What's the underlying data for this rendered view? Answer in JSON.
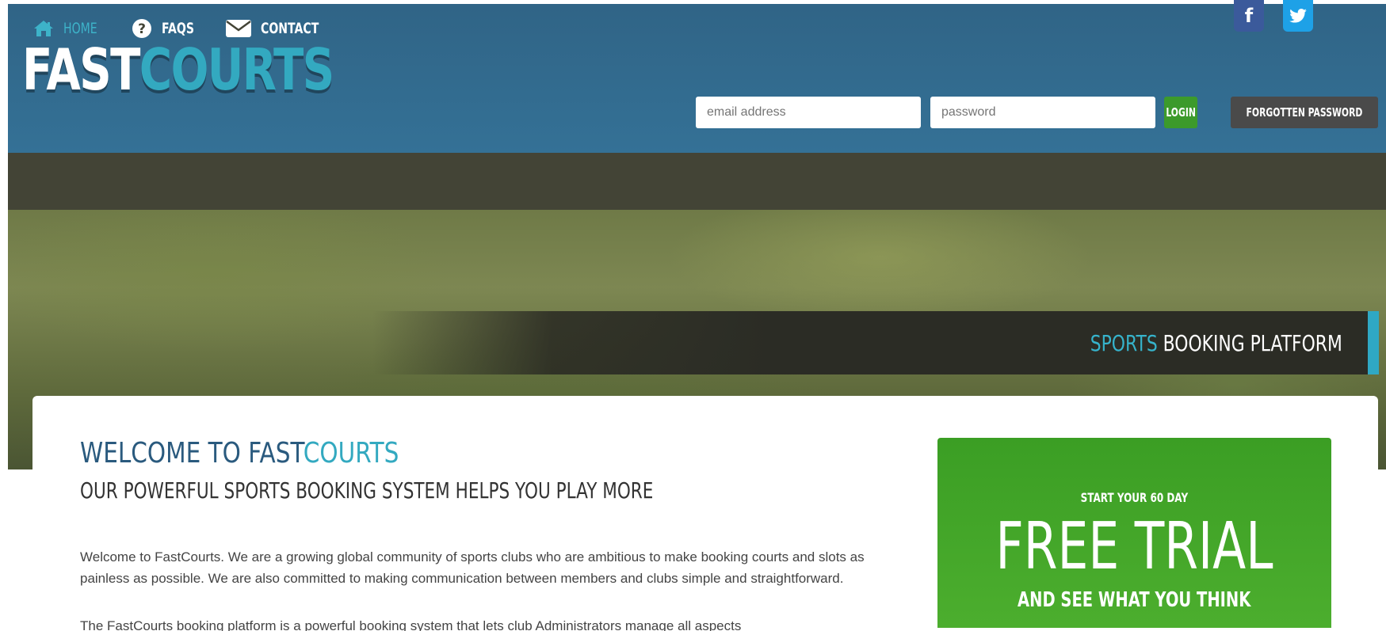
{
  "brand": {
    "logo_part1": "FAST",
    "logo_part2": "COURTS"
  },
  "social": {
    "facebook_label": "f"
  },
  "login": {
    "email_placeholder": "email address",
    "password_placeholder": "password",
    "login_label": "LOGIN",
    "forgot_label": "FORGOTTEN PASSWORD"
  },
  "nav": {
    "items": [
      {
        "label": "HOME",
        "icon": "home-icon",
        "active": true
      },
      {
        "label": "FAQS",
        "icon": "question-circle-icon",
        "active": false
      },
      {
        "label": "CONTACT",
        "icon": "envelope-icon",
        "active": false
      }
    ]
  },
  "banner": {
    "highlight": "SPORTS",
    "rest": " BOOKING PLATFORM"
  },
  "main": {
    "welcome_part1": "WELCOME TO FAST",
    "welcome_part2": "COURTS",
    "subtitle": "OUR POWERFUL SPORTS BOOKING SYSTEM HELPS YOU PLAY MORE",
    "paragraph1": "Welcome to FastCourts. We are a growing global community of sports clubs who are ambitious to make booking courts and slots as painless as possible. We are also committed to making communication between members and clubs simple and straightforward.",
    "paragraph2": "The FastCourts booking platform is a powerful booking system that lets club Administrators manage all aspects"
  },
  "trial": {
    "line1": "START YOUR 60 DAY",
    "line2": "FREE TRIAL",
    "line3": "AND SEE WHAT YOU THINK"
  },
  "colors": {
    "header_blue": "#336b90",
    "accent_teal": "#33a9c0",
    "nav_dark": "#434436",
    "login_green": "#3c9a2b",
    "trial_green": "#4cae2e"
  }
}
